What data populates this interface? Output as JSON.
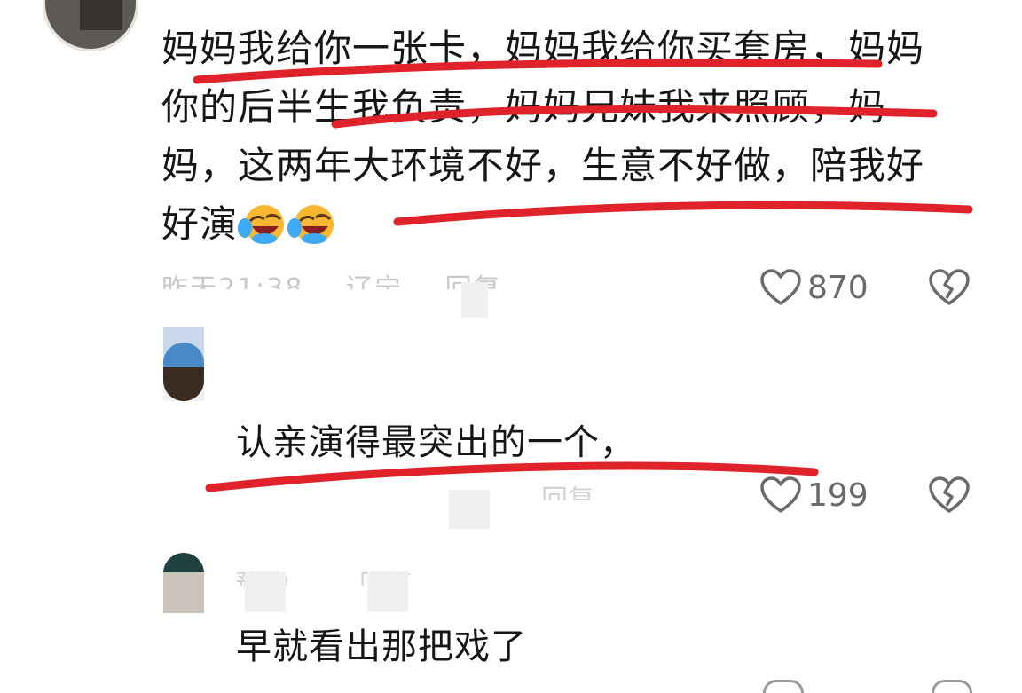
{
  "comment": {
    "line1": "妈妈我给你一张卡，妈妈我给你买套房，妈妈",
    "line2": "你的后半生我负责，妈妈兄妹我来照顾，妈",
    "line3": "妈，这两年大环境不好，生意不好做，陪我好",
    "line4": "好演",
    "meta_time": "昨天21:38",
    "meta_location": "辽宁",
    "meta_reply": "回复",
    "likes": "870"
  },
  "reply1": {
    "text": "认亲演得最突出的一个，",
    "meta_reply": "回复",
    "likes": "199"
  },
  "reply2": {
    "username": "豫豫",
    "author_tag": "回复",
    "text": "早就看出那把戏了"
  },
  "colors": {
    "annotation": "#e0222a",
    "text": "#161616",
    "muted": "#6a6a6a"
  },
  "icons": [
    "heart-outline-icon",
    "broken-heart-icon",
    "laughing-crying-emoji"
  ]
}
